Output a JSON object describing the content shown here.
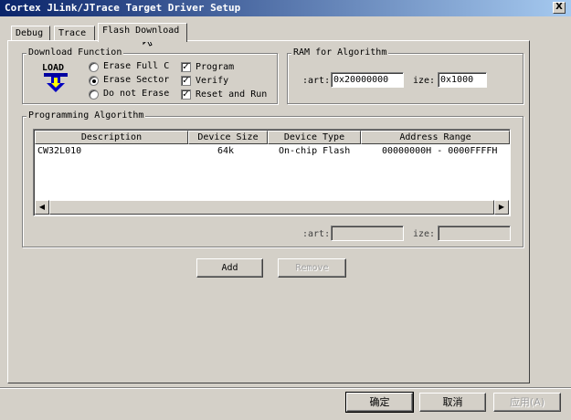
{
  "window": {
    "title": "Cortex JLink/JTrace Target Driver Setup",
    "close_glyph": "X"
  },
  "tabs": [
    {
      "label": "Debug"
    },
    {
      "label": "Trace"
    },
    {
      "label": "Flash Download",
      "active": true
    }
  ],
  "download_function": {
    "legend": "Download Function",
    "icon_text": "LOAD",
    "erase_options": [
      {
        "label": "Erase Full C",
        "selected": false
      },
      {
        "label": "Erase Sector",
        "selected": true
      },
      {
        "label": "Do not Erase",
        "selected": false
      }
    ],
    "checks": [
      {
        "label": "Program",
        "checked": true
      },
      {
        "label": "Verify",
        "checked": true
      },
      {
        "label": "Reset and Run",
        "checked": true
      }
    ],
    "check_glyph": "✓"
  },
  "ram_for_algorithm": {
    "legend": "RAM for Algorithm",
    "start_label": ":art:",
    "start_value": "0x20000000",
    "size_label": "ize:",
    "size_value": "0x1000"
  },
  "programming_algorithm": {
    "legend": "Programming Algorithm",
    "columns": [
      "Description",
      "Device Size",
      "Device Type",
      "Address Range"
    ],
    "rows": [
      {
        "description": "CW32L010",
        "size": "64k",
        "type": "On-chip Flash",
        "range": "00000000H - 0000FFFFH"
      }
    ],
    "start_label": ":art:",
    "start_value": "",
    "size_label": "ize:",
    "size_value": "",
    "scroll_left": "◀",
    "scroll_right": "▶"
  },
  "buttons": {
    "add": "Add",
    "remove": "Remove",
    "ok": "确定",
    "cancel": "取消",
    "apply": "应用(A)"
  }
}
